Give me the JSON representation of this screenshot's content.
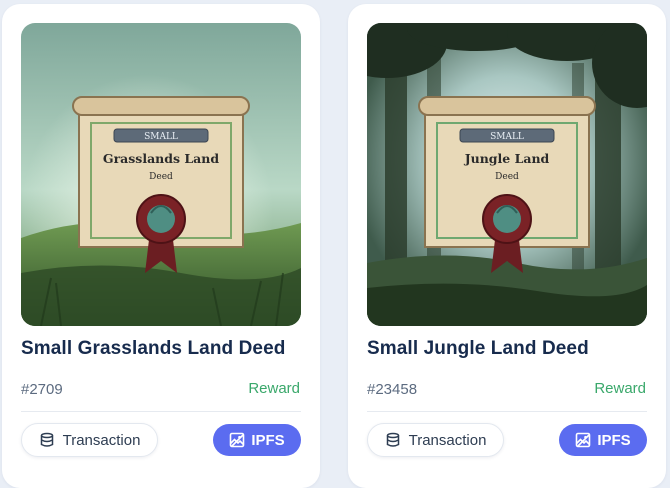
{
  "cards": [
    {
      "art": {
        "badge": "SMALL",
        "deed_name": "Grasslands Land",
        "deed_sub": "Deed",
        "theme": "grasslands"
      },
      "title": "Small Grasslands Land Deed",
      "token_id": "#2709",
      "status": "Reward",
      "transaction_label": "Transaction",
      "ipfs_label": "IPFS"
    },
    {
      "art": {
        "badge": "SMALL",
        "deed_name": "Jungle Land",
        "deed_sub": "Deed",
        "theme": "jungle"
      },
      "title": "Small Jungle Land Deed",
      "token_id": "#23458",
      "status": "Reward",
      "transaction_label": "Transaction",
      "ipfs_label": "IPFS"
    }
  ],
  "icons": {
    "transaction": "database-icon",
    "ipfs": "image-icon"
  },
  "colors": {
    "accent": "#5b6cf0",
    "reward": "#3aa86b",
    "title": "#172b4d"
  }
}
